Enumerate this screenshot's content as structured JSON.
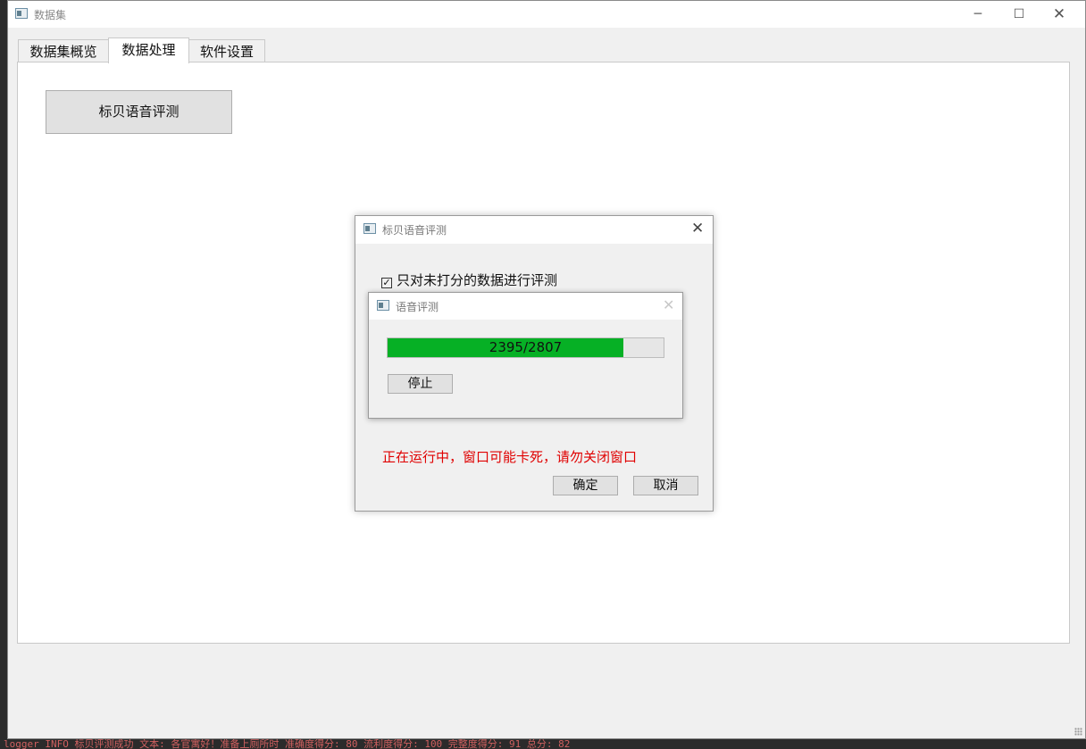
{
  "main_window": {
    "title": "数据集",
    "icon": "window-icon",
    "controls": {
      "minimize": "─",
      "maximize": "☐",
      "close": "✕"
    }
  },
  "tabs": [
    {
      "label": "数据集概览",
      "active": false
    },
    {
      "label": "数据处理",
      "active": true
    },
    {
      "label": "软件设置",
      "active": false
    }
  ],
  "panel": {
    "action_button_label": "标贝语音评测"
  },
  "dialog": {
    "title": "标贝语音评测",
    "close": "✕",
    "checkbox_label": "只对未打分的数据进行评测",
    "checkbox_checked": true,
    "warning": "正在运行中，窗口可能卡死，请勿关闭窗口",
    "warning_color": "#e00000",
    "ok_label": "确定",
    "cancel_label": "取消"
  },
  "progress_dialog": {
    "title": "语音评测",
    "close": "✕",
    "progress_text": "2395/2807",
    "progress_value": 2395,
    "progress_max": 2807,
    "progress_color": "#06b025",
    "stop_label": "停止"
  },
  "background_log": {
    "bottom_line": "logger   INFO   标贝评测成功  文本:  各官寓好！准备上厕所时  准确度得分: 80  流利度得分: 100  完整度得分: 91  总分: 82"
  }
}
